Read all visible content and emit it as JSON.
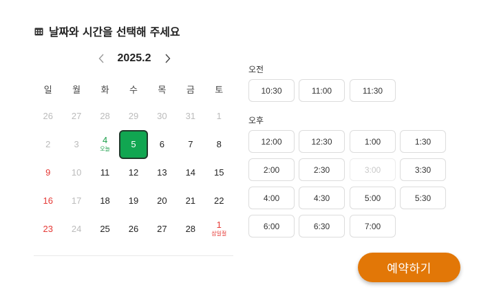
{
  "header": {
    "title": "날짜와 시간을 선택해 주세요",
    "icon": "calendar-icon"
  },
  "calendar": {
    "month_label": "2025.2",
    "prev_icon": "chevron-left-icon",
    "next_icon": "chevron-right-icon",
    "weekdays": [
      "일",
      "월",
      "화",
      "수",
      "목",
      "금",
      "토"
    ],
    "weeks": [
      [
        {
          "n": "26",
          "s": "muted"
        },
        {
          "n": "27",
          "s": "muted"
        },
        {
          "n": "28",
          "s": "muted"
        },
        {
          "n": "29",
          "s": "muted"
        },
        {
          "n": "30",
          "s": "muted"
        },
        {
          "n": "31",
          "s": "muted"
        },
        {
          "n": "1",
          "s": "muted"
        }
      ],
      [
        {
          "n": "2",
          "s": "muted"
        },
        {
          "n": "3",
          "s": "muted"
        },
        {
          "n": "4",
          "s": "today",
          "sub": "오늘"
        },
        {
          "n": "5",
          "s": "selected"
        },
        {
          "n": "6",
          "s": ""
        },
        {
          "n": "7",
          "s": ""
        },
        {
          "n": "8",
          "s": ""
        }
      ],
      [
        {
          "n": "9",
          "s": "holiday"
        },
        {
          "n": "10",
          "s": "muted"
        },
        {
          "n": "11",
          "s": ""
        },
        {
          "n": "12",
          "s": ""
        },
        {
          "n": "13",
          "s": ""
        },
        {
          "n": "14",
          "s": ""
        },
        {
          "n": "15",
          "s": ""
        }
      ],
      [
        {
          "n": "16",
          "s": "holiday"
        },
        {
          "n": "17",
          "s": "muted"
        },
        {
          "n": "18",
          "s": ""
        },
        {
          "n": "19",
          "s": ""
        },
        {
          "n": "20",
          "s": ""
        },
        {
          "n": "21",
          "s": ""
        },
        {
          "n": "22",
          "s": ""
        }
      ],
      [
        {
          "n": "23",
          "s": "holiday"
        },
        {
          "n": "24",
          "s": "muted"
        },
        {
          "n": "25",
          "s": ""
        },
        {
          "n": "26",
          "s": ""
        },
        {
          "n": "27",
          "s": ""
        },
        {
          "n": "28",
          "s": ""
        },
        {
          "n": "1",
          "s": "holiday",
          "sub": "삼일절"
        }
      ]
    ]
  },
  "times": {
    "am_label": "오전",
    "am_slots": [
      {
        "t": "10:30",
        "enabled": true
      },
      {
        "t": "11:00",
        "enabled": true
      },
      {
        "t": "11:30",
        "enabled": true
      }
    ],
    "pm_label": "오후",
    "pm_slots": [
      {
        "t": "12:00",
        "enabled": true
      },
      {
        "t": "12:30",
        "enabled": true
      },
      {
        "t": "1:00",
        "enabled": true
      },
      {
        "t": "1:30",
        "enabled": true
      },
      {
        "t": "2:00",
        "enabled": true
      },
      {
        "t": "2:30",
        "enabled": true
      },
      {
        "t": "3:00",
        "enabled": false
      },
      {
        "t": "3:30",
        "enabled": true
      },
      {
        "t": "4:00",
        "enabled": true
      },
      {
        "t": "4:30",
        "enabled": true
      },
      {
        "t": "5:00",
        "enabled": true
      },
      {
        "t": "5:30",
        "enabled": true
      },
      {
        "t": "6:00",
        "enabled": true
      },
      {
        "t": "6:30",
        "enabled": true
      },
      {
        "t": "7:00",
        "enabled": true
      }
    ]
  },
  "reserve_button": {
    "label": "예약하기",
    "color": "#e27707"
  },
  "colors": {
    "selected": "#11a651",
    "today": "#1a9e4a",
    "holiday": "#e53935",
    "muted": "#bbbbbb"
  }
}
